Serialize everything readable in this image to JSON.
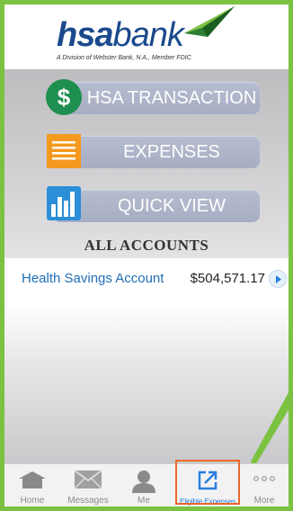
{
  "brand": {
    "logo_hsa": "hsa",
    "logo_bank": "bank",
    "tagline": "A Division of Webster Bank, N.A., Member FDIC",
    "colors": {
      "frame": "#7cc242",
      "logo_blue": "#1b4a8c",
      "pill": "#a6adc3",
      "active": "#2a7de1",
      "highlight": "#e86a2a"
    }
  },
  "menu": [
    {
      "label": "HSA TRANSACTION",
      "icon": "dollar-icon"
    },
    {
      "label": "EXPENSES",
      "icon": "receipt-icon"
    },
    {
      "label": "QUICK VIEW",
      "icon": "bar-chart-icon"
    }
  ],
  "accounts_heading": "ALL ACCOUNTS",
  "accounts": [
    {
      "name": "Health Savings Account",
      "balance": "$504,571.17"
    }
  ],
  "tabbar": [
    {
      "label": "Home",
      "icon": "home-icon",
      "active": false
    },
    {
      "label": "Messages",
      "icon": "envelope-icon",
      "active": false
    },
    {
      "label": "Me",
      "icon": "person-icon",
      "active": false
    },
    {
      "label": "Eligible Expenses",
      "icon": "external-link-icon",
      "active": true
    },
    {
      "label": "More",
      "icon": "more-icon",
      "active": false
    }
  ]
}
